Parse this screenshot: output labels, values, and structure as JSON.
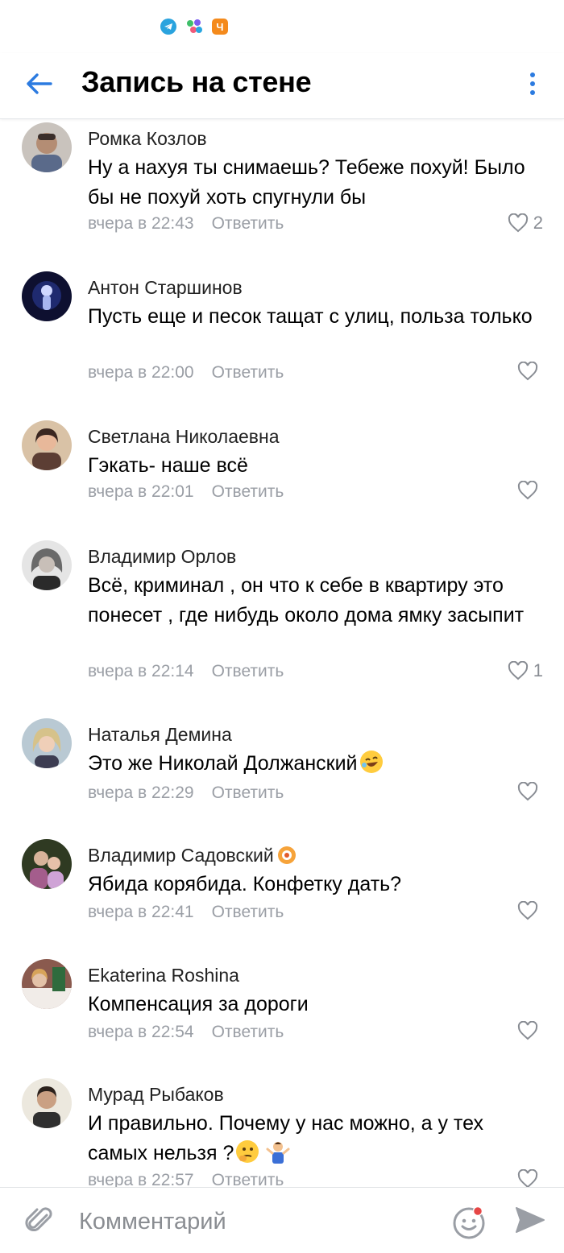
{
  "header": {
    "title": "Запись на стене"
  },
  "comments": [
    {
      "author": "Ромка Козлов",
      "text": "Ну а нахуя ты снимаешь? Тебеже похуй! Было бы не похуй хоть спугнули бы",
      "time": "вчера в 22:43",
      "reply": "Ответить",
      "likes": "2",
      "avatar_color": "#8a7565"
    },
    {
      "author": "Антон Старшинов",
      "text": "Пусть еще и песок тащат с улиц, польза только",
      "time": "вчера в 22:00",
      "reply": "Ответить",
      "likes": "",
      "avatar_color": "#13162e"
    },
    {
      "author": "Светлана Николаевна",
      "text": "Гэкать- наше всё",
      "time": "вчера в 22:01",
      "reply": "Ответить",
      "likes": "",
      "avatar_color": "#9a6e55"
    },
    {
      "author": "Владимир Орлов",
      "text": "Всё, криминал , он что к себе в квартиру это понесет , где нибудь около дома ямку засыпит",
      "time": "вчера в 22:14",
      "reply": "Ответить",
      "likes": "1",
      "avatar_color": "#7c7c7c"
    },
    {
      "author": "Наталья Демина",
      "text": "Это же Николай Должанский",
      "time": "вчера в 22:29",
      "reply": "Ответить",
      "likes": "",
      "avatar_color": "#8fa7b6"
    },
    {
      "author": "Владимир Садовский",
      "text": "Ябида корябида. Конфетку дать?",
      "time": "вчера в 22:41",
      "reply": "Ответить",
      "likes": "",
      "avatar_color": "#4e5a3a"
    },
    {
      "author": "Ekaterina Roshina",
      "text": "Компенсация за дороги",
      "time": "вчера в 22:54",
      "reply": "Ответить",
      "likes": "",
      "avatar_color": "#6c4f48"
    },
    {
      "author": "Мурад Рыбаков",
      "text": "И правильно. Почему у нас можно, а у тех самых нельзя ?",
      "time": "вчера в 22:57",
      "reply": "Ответить",
      "likes": "",
      "avatar_color": "#e7e2d6"
    }
  ],
  "input": {
    "placeholder": "Комментарий"
  },
  "colors": {
    "accent": "#2c7be0",
    "meta": "#9a9ea5"
  },
  "icons": [
    "back-arrow-icon",
    "more-vertical-icon",
    "heart-icon",
    "paperclip-icon",
    "emoji-icon",
    "send-icon"
  ]
}
